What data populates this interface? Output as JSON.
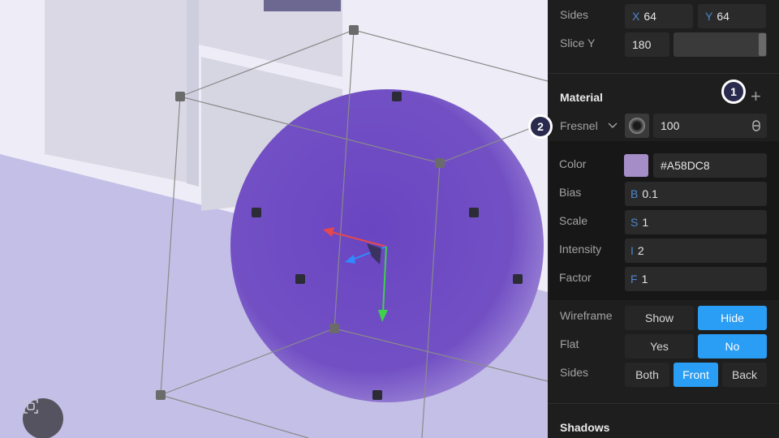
{
  "viewport": {
    "focus_icon": "focus-frame-icon"
  },
  "sphere": {
    "color": "#6f4ebf"
  },
  "panel": {
    "sides": {
      "label": "Sides",
      "x_prefix": "X",
      "x_value": "64",
      "y_prefix": "Y",
      "y_value": "64"
    },
    "slice_y": {
      "label": "Slice Y",
      "value": "180"
    },
    "material": {
      "title": "Material",
      "add_icon": "plus-icon",
      "type": "Fresnel",
      "opacity": "100",
      "opacity_icon": "link-icon"
    },
    "fresnel": {
      "color_label": "Color",
      "color_value": "#A58DC8",
      "swatch": "#a58dc8",
      "bias_label": "Bias",
      "bias_prefix": "B",
      "bias_value": "0.1",
      "scale_label": "Scale",
      "scale_prefix": "S",
      "scale_value": "1",
      "intensity_label": "Intensity",
      "intensity_prefix": "I",
      "intensity_value": "2",
      "factor_label": "Factor",
      "factor_prefix": "F",
      "factor_value": "1"
    },
    "wireframe": {
      "label": "Wireframe",
      "show": "Show",
      "hide": "Hide",
      "selected": "Hide"
    },
    "flat": {
      "label": "Flat",
      "yes": "Yes",
      "no": "No",
      "selected": "No"
    },
    "sides2": {
      "label": "Sides",
      "both": "Both",
      "front": "Front",
      "back": "Back",
      "selected": "Front"
    },
    "shadows": {
      "title": "Shadows"
    }
  },
  "badges": {
    "one": "1",
    "two": "2"
  }
}
